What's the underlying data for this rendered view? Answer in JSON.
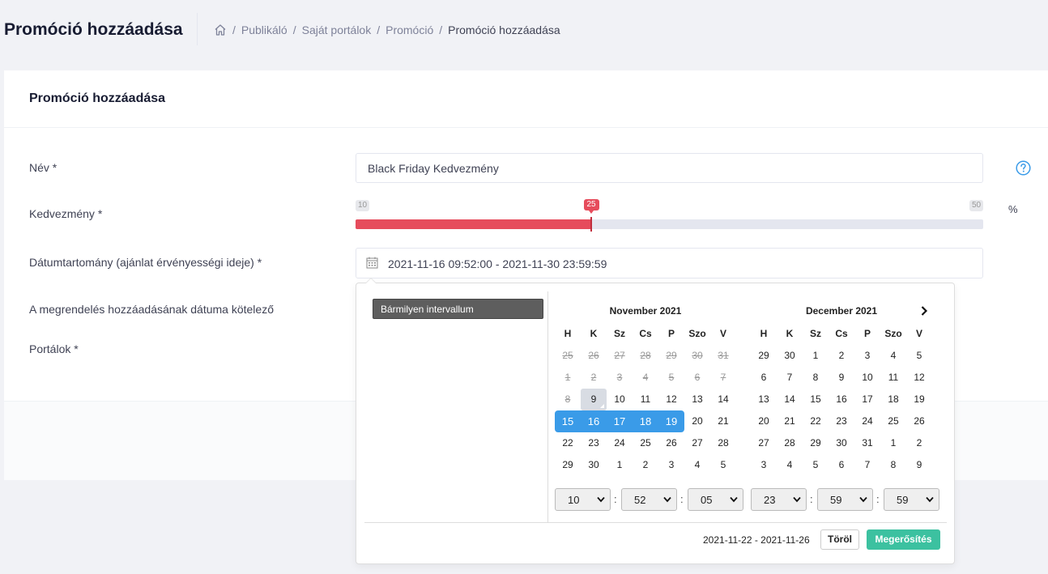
{
  "header": {
    "title": "Promóció hozzáadása",
    "breadcrumb": [
      "Publikáló",
      "Saját portálok",
      "Promóció",
      "Promóció hozzáadása"
    ],
    "separator": "/"
  },
  "card": {
    "title": "Promóció hozzáadása"
  },
  "form": {
    "name_label": "Név *",
    "name_value": "Black Friday Kedvezmény",
    "discount_label": "Kedvezmény *",
    "discount": {
      "min": "10",
      "max": "50",
      "value": "25",
      "unit": "%"
    },
    "date_label": "Dátumtartomány (ajánlat érvényességi ideje) *",
    "date_value": "2021-11-16 09:52:00 - 2021-11-30 23:59:59",
    "order_date_label": "A megrendelés hozzáadásának dátuma kötelező",
    "portals_label": "Portálok *"
  },
  "picker": {
    "range_option": "Bármilyen intervallum",
    "weekdays": [
      "H",
      "K",
      "Sz",
      "Cs",
      "P",
      "Szo",
      "V"
    ],
    "left": {
      "title": "November 2021",
      "days": [
        "25",
        "26",
        "27",
        "28",
        "29",
        "30",
        "31",
        "1",
        "2",
        "3",
        "4",
        "5",
        "6",
        "7",
        "8",
        "9",
        "10",
        "11",
        "12",
        "13",
        "14",
        "15",
        "16",
        "17",
        "18",
        "19",
        "20",
        "21",
        "22",
        "23",
        "24",
        "25",
        "26",
        "27",
        "28",
        "29",
        "30",
        "1",
        "2",
        "3",
        "4",
        "5"
      ],
      "disabled_count": 15,
      "today_index": 15,
      "range_start_index": 21,
      "range_end_index": 25
    },
    "right": {
      "title": "December 2021",
      "days": [
        "29",
        "30",
        "1",
        "2",
        "3",
        "4",
        "5",
        "6",
        "7",
        "8",
        "9",
        "10",
        "11",
        "12",
        "13",
        "14",
        "15",
        "16",
        "17",
        "18",
        "19",
        "20",
        "21",
        "22",
        "23",
        "24",
        "25",
        "26",
        "27",
        "28",
        "29",
        "30",
        "31",
        "1",
        "2",
        "3",
        "4",
        "5",
        "6",
        "7",
        "8",
        "9"
      ]
    },
    "time_left": {
      "hour": "10",
      "minute": "52",
      "second": "05"
    },
    "time_right": {
      "hour": "23",
      "minute": "59",
      "second": "59"
    },
    "time_sep": ":",
    "selected_range": "2021-11-22 - 2021-11-26",
    "clear_label": "Töröl",
    "apply_label": "Megerősítés"
  },
  "colors": {
    "accent": "#e64c5c",
    "range": "#3a9be8",
    "apply": "#3cc1a0",
    "help": "#3a9be8"
  },
  "icons": [
    "home-icon",
    "help-icon",
    "calendar-icon",
    "chevron-right-icon",
    "chevron-down-icon"
  ]
}
